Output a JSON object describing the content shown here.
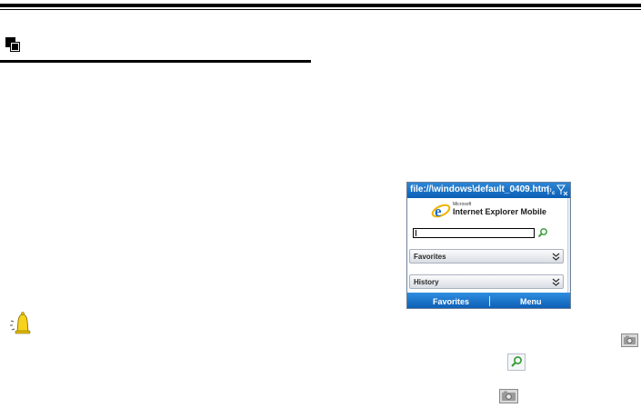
{
  "device": {
    "title_url": "file://\\windows\\default_0409.htm",
    "logo_small": "Microsoft",
    "logo_big": "Internet Explorer Mobile",
    "address_value": "",
    "panels": [
      {
        "label": "Favorites"
      },
      {
        "label": "History"
      }
    ],
    "softkeys": {
      "left": "Favorites",
      "right": "Menu"
    }
  },
  "icons": {
    "section": "section-heading-icon",
    "note": "bell-icon",
    "go": "search-icon",
    "camera": "camera-icon"
  },
  "colors": {
    "titlebar": "#0b5fb5",
    "softkey_bar": "#0a5ab0",
    "bell": "#f6d21c"
  }
}
